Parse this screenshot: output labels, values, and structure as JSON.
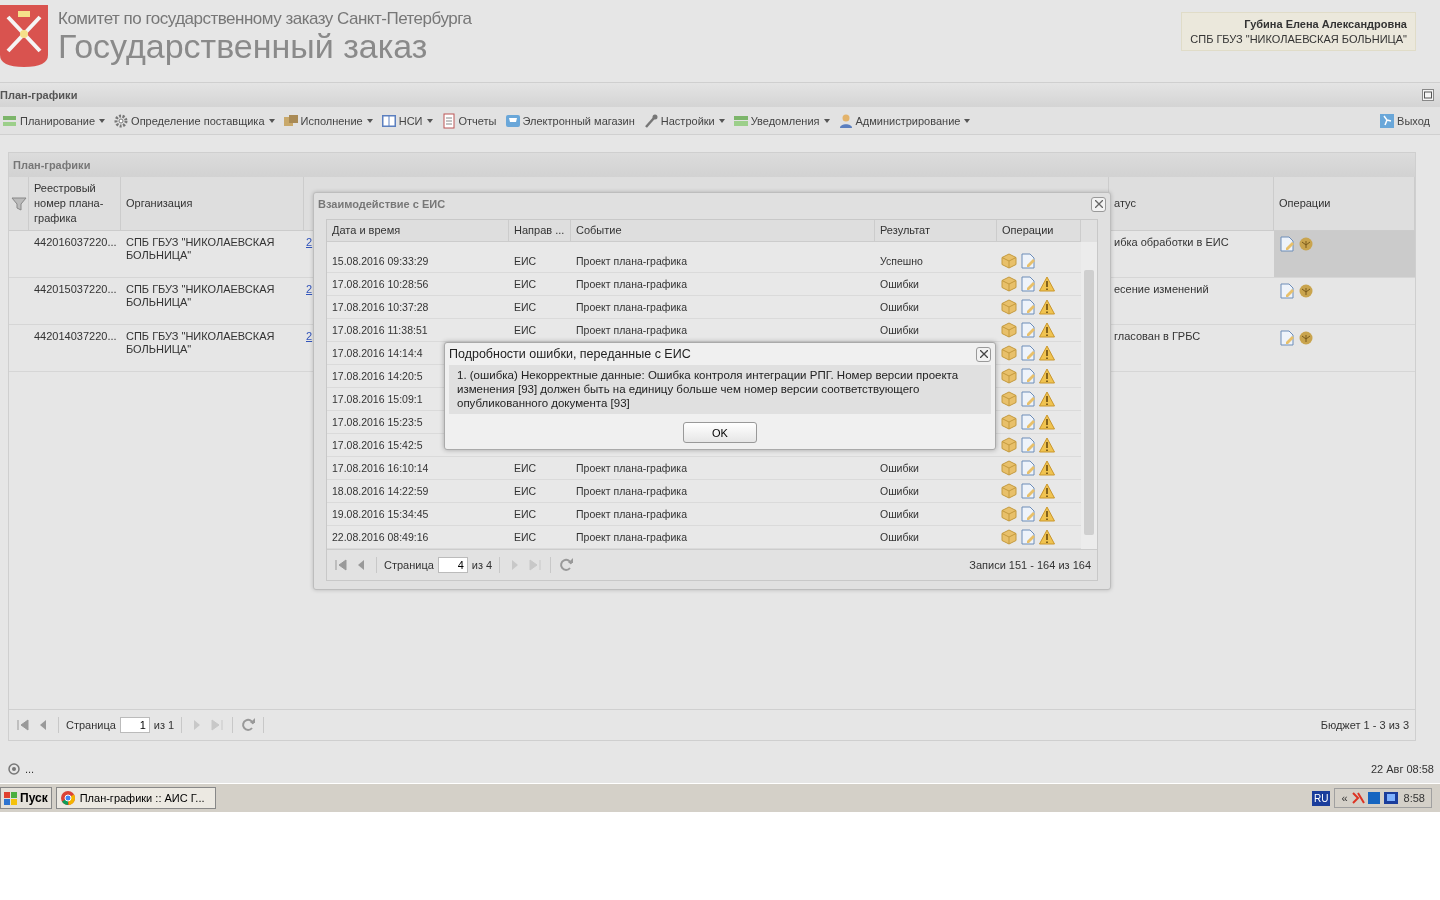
{
  "header": {
    "org_title": "Комитет по государственному заказу Санкт-Петербурга",
    "app_title": "Государственный заказ",
    "user": {
      "name": "Губина Елена Александровна",
      "organization": "СПБ ГБУЗ \"НИКОЛАЕВСКАЯ БОЛЬНИЦА\""
    }
  },
  "section_bar": {
    "title": "План-графики"
  },
  "menu": [
    {
      "label": "Планирование",
      "has_menu": true
    },
    {
      "label": "Определение поставщика",
      "has_menu": true
    },
    {
      "label": "Исполнение",
      "has_menu": true
    },
    {
      "label": "НСИ",
      "has_menu": true
    },
    {
      "label": "Отчеты",
      "has_menu": false
    },
    {
      "label": "Электронный магазин",
      "has_menu": false
    },
    {
      "label": "Настройки",
      "has_menu": true
    },
    {
      "label": "Уведомления",
      "has_menu": true
    },
    {
      "label": "Администрирование",
      "has_menu": true
    }
  ],
  "exit_button": {
    "label": "Выход"
  },
  "panel": {
    "title": "План-графики",
    "columns": [
      "Реестровый номер плана-графика",
      "Организация",
      "атус",
      "Операции"
    ],
    "rows": [
      {
        "reg_number": "442016037220...",
        "organization": "СПБ ГБУЗ \"НИКОЛАЕВСКАЯ БОЛЬНИЦА\"",
        "link": "2",
        "status": "ибка обработки в ЕИС",
        "selected": true
      },
      {
        "reg_number": "442015037220...",
        "organization": "СПБ ГБУЗ \"НИКОЛАЕВСКАЯ БОЛЬНИЦА\"",
        "link": "2",
        "status": "есение изменений",
        "selected": false
      },
      {
        "reg_number": "442014037220...",
        "organization": "СПБ ГБУЗ \"НИКОЛАЕВСКАЯ БОЛЬНИЦА\"",
        "link": "2",
        "status": "гласован в ГРБС",
        "selected": false
      }
    ],
    "paging": {
      "page_label": "Страница",
      "page": "1",
      "of": "из 1",
      "summary": "Бюджет 1 - 3 из 3"
    }
  },
  "eis_dialog": {
    "title": "Взаимодействие с ЕИС",
    "columns": [
      "Дата и время",
      "Направ ...",
      "Событие",
      "Результат",
      "Операции"
    ],
    "rows": [
      {
        "date": "15.08.2016 09:33:29",
        "direction": "ЕИС",
        "event": "Проект плана-графика",
        "result": "Успешно",
        "warning": false
      },
      {
        "date": "17.08.2016 10:28:56",
        "direction": "ЕИС",
        "event": "Проект плана-графика",
        "result": "Ошибки",
        "warning": true
      },
      {
        "date": "17.08.2016 10:37:28",
        "direction": "ЕИС",
        "event": "Проект плана-графика",
        "result": "Ошибки",
        "warning": true
      },
      {
        "date": "17.08.2016 11:38:51",
        "direction": "ЕИС",
        "event": "Проект плана-графика",
        "result": "Ошибки",
        "warning": true
      },
      {
        "date": "17.08.2016 14:14:4",
        "warning": true
      },
      {
        "date": "17.08.2016 14:20:5",
        "warning": true
      },
      {
        "date": "17.08.2016 15:09:1",
        "warning": true
      },
      {
        "date": "17.08.2016 15:23:5",
        "warning": true
      },
      {
        "date": "17.08.2016 15:42:5",
        "warning": true
      },
      {
        "date": "17.08.2016 16:10:14",
        "direction": "ЕИС",
        "event": "Проект плана-графика",
        "result": "Ошибки",
        "warning": true
      },
      {
        "date": "18.08.2016 14:22:59",
        "direction": "ЕИС",
        "event": "Проект плана-графика",
        "result": "Ошибки",
        "warning": true
      },
      {
        "date": "19.08.2016 15:34:45",
        "direction": "ЕИС",
        "event": "Проект плана-графика",
        "result": "Ошибки",
        "warning": true
      },
      {
        "date": "22.08.2016 08:49:16",
        "direction": "ЕИС",
        "event": "Проект плана-графика",
        "result": "Ошибки",
        "warning": true
      }
    ],
    "paging": {
      "page_label": "Страница",
      "page": "4",
      "of": "из 4",
      "summary": "Записи 151 - 164 из 164"
    }
  },
  "error_dialog": {
    "title": "Подробности ошибки, переданные с ЕИС",
    "message": "1. (ошибка) Некорректные данные: Ошибка контроля интеграции РПГ. Номер версии проекта изменения [93] должен быть на единицу больше чем номер версии соответствующего опубликованного документа [93]",
    "ok_button": "OK"
  },
  "status_bar": {
    "left": "...",
    "right": "22 Авг 08:58"
  },
  "taskbar": {
    "start": "Пуск",
    "task": "План-графики :: АИС Г...",
    "language": "RU",
    "tray_toggle": "«",
    "clock": "8:58"
  }
}
